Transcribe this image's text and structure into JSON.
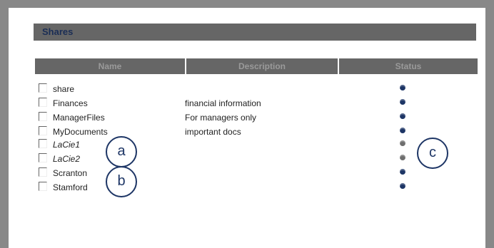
{
  "section": {
    "title": "Shares"
  },
  "columns": {
    "name": "Name",
    "description": "Description",
    "status": "Status"
  },
  "shares": [
    {
      "name": "share",
      "description": "",
      "status_color": "#1d3565"
    },
    {
      "name": "Finances",
      "description": "financial information",
      "status_color": "#1d3565"
    },
    {
      "name": "ManagerFiles",
      "description": "For managers only",
      "status_color": "#1d3565"
    },
    {
      "name": "MyDocuments",
      "description": "important docs",
      "status_color": "#1d3565"
    },
    {
      "name": "LaCie1",
      "description": "",
      "status_color": "#6e6e6e"
    },
    {
      "name": "LaCie2",
      "description": "",
      "status_color": "#6e6e6e"
    },
    {
      "name": "Scranton",
      "description": "",
      "status_color": "#1d3565"
    },
    {
      "name": "Stamford",
      "description": "",
      "status_color": "#1d3565"
    }
  ],
  "callouts": {
    "a": "a",
    "b": "b",
    "c": "c"
  }
}
